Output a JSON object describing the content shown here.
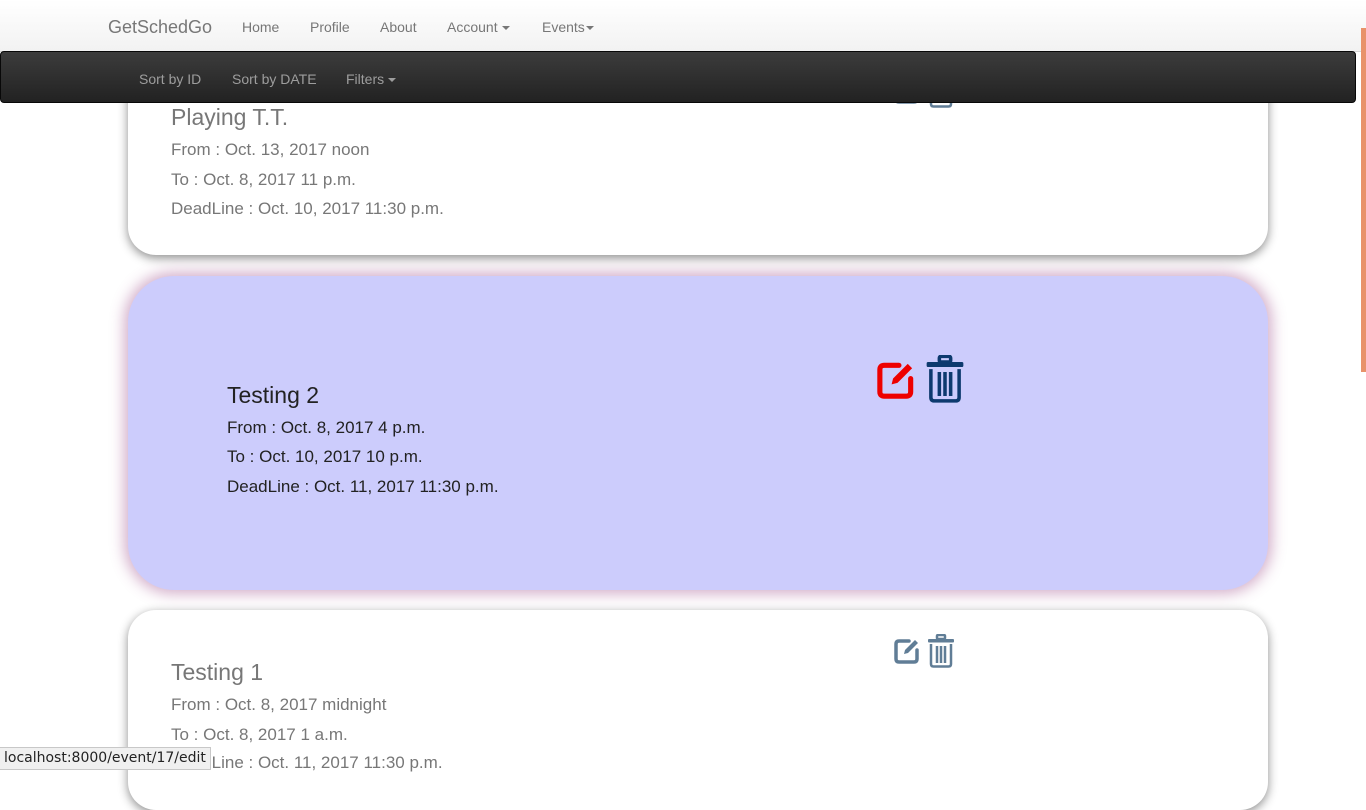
{
  "navbar": {
    "brand": "GetSchedGo",
    "items": [
      {
        "label": "Home"
      },
      {
        "label": "Profile"
      },
      {
        "label": "About"
      },
      {
        "label": "Account"
      },
      {
        "label": "Events"
      }
    ]
  },
  "subnav": {
    "items": [
      {
        "label": "Sort by ID"
      },
      {
        "label": "Sort by DATE"
      },
      {
        "label": "Filters"
      }
    ]
  },
  "events": [
    {
      "title": "Playing T.T.",
      "from": "From : Oct. 13, 2017 noon",
      "to": "To : Oct. 8, 2017 11 p.m.",
      "deadline": "DeadLine : Oct. 10, 2017 11:30 p.m."
    },
    {
      "title": "Testing 2",
      "from": "From : Oct. 8, 2017 4 p.m.",
      "to": "To : Oct. 10, 2017 10 p.m.",
      "deadline": "DeadLine : Oct. 11, 2017 11:30 p.m."
    },
    {
      "title": "Testing 1",
      "from": "From : Oct. 8, 2017 midnight",
      "to": "To : Oct. 8, 2017 1 a.m.",
      "deadline": "DeadLine : Oct. 11, 2017 11:30 p.m."
    }
  ],
  "icons": {
    "edit": "edit-icon",
    "delete": "trash-icon"
  },
  "colors": {
    "icon_default": "#607d96",
    "edit_active": "#ee0000",
    "trash_active": "#0d3a6e",
    "active_card_bg": "#ccccfc",
    "scroll_thumb": "#e8926a"
  },
  "statusbar": {
    "url": "localhost:8000/event/17/edit"
  }
}
